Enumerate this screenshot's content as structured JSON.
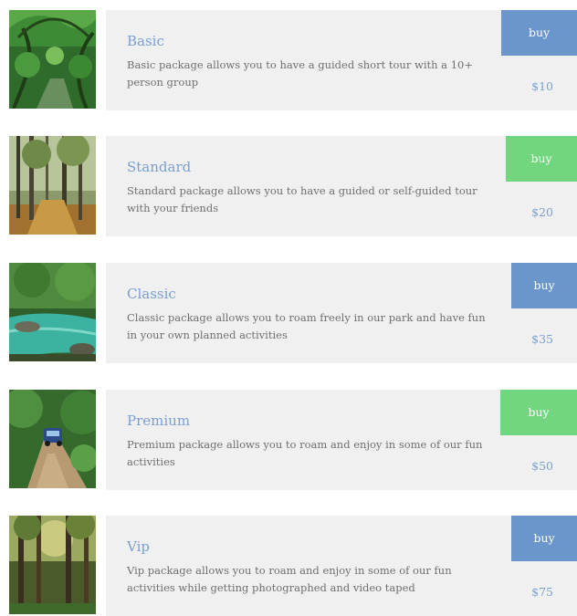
{
  "packages": [
    {
      "name": "Basic",
      "description": "Basic package allows you to have a guided short tour with a 10+ person group",
      "buy_label": "buy",
      "price": "$10",
      "button_color": "#6a96cc",
      "image_icon": "forest-path-image"
    },
    {
      "name": "Standard",
      "description": "Standard package allows you to have a guided or self-guided tour with your friends",
      "buy_label": "buy",
      "price": "$20",
      "button_color": "#72d67f",
      "image_icon": "sunlit-forest-image"
    },
    {
      "name": "Classic",
      "description": "Classic package allows you to roam freely in our park and have fun in your own planned activities",
      "buy_label": "buy",
      "price": "$35",
      "button_color": "#6a96cc",
      "image_icon": "river-forest-image"
    },
    {
      "name": "Premium",
      "description": "Premium package allows you to roam and enjoy in some of our fun activities",
      "buy_label": "buy",
      "price": "$50",
      "button_color": "#72d67f",
      "image_icon": "jungle-trail-jeep-image"
    },
    {
      "name": "Vip",
      "description": "Vip package allows you to roam and enjoy in some of our fun activities while getting photographed and video taped",
      "buy_label": "buy",
      "price": "$75",
      "button_color": "#6a96cc",
      "image_icon": "tall-trees-image"
    }
  ]
}
